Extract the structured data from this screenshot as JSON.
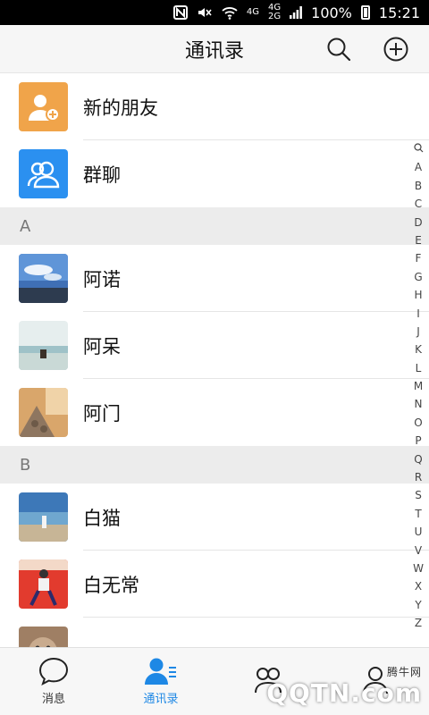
{
  "status_bar": {
    "network_top": "4G",
    "network_bottom": "4G",
    "network_small": "2G",
    "battery": "100%",
    "time": "15:21"
  },
  "header": {
    "title": "通讯录",
    "search_icon": "search-icon",
    "add_icon": "add-circle-icon"
  },
  "colors": {
    "new_friends": "#f0a44a",
    "group_chat": "#2b90f0",
    "accent": "#1e88e5",
    "section_bg": "#ececec"
  },
  "top_items": [
    {
      "label": "新的朋友",
      "icon": "add-friend-icon"
    },
    {
      "label": "群聊",
      "icon": "group-icon"
    }
  ],
  "sections": [
    {
      "letter": "A",
      "contacts": [
        {
          "name": "阿诺"
        },
        {
          "name": "阿呆"
        },
        {
          "name": "阿门"
        }
      ]
    },
    {
      "letter": "B",
      "contacts": [
        {
          "name": "白猫"
        },
        {
          "name": "白无常"
        },
        {
          "name": ""
        }
      ]
    }
  ],
  "index": [
    "A",
    "B",
    "C",
    "D",
    "E",
    "F",
    "G",
    "H",
    "I",
    "J",
    "K",
    "L",
    "M",
    "N",
    "O",
    "P",
    "Q",
    "R",
    "S",
    "T",
    "U",
    "V",
    "W",
    "X",
    "Y",
    "Z"
  ],
  "tabbar": [
    {
      "label": "消息",
      "icon": "chat-bubble-icon",
      "active": false
    },
    {
      "label": "通讯录",
      "icon": "contacts-icon",
      "active": true
    },
    {
      "label": "",
      "icon": "discover-icon",
      "active": false
    },
    {
      "label": "",
      "icon": "profile-icon",
      "active": false
    }
  ],
  "watermark": {
    "text": "QQTN.com",
    "small": "腾牛网"
  }
}
